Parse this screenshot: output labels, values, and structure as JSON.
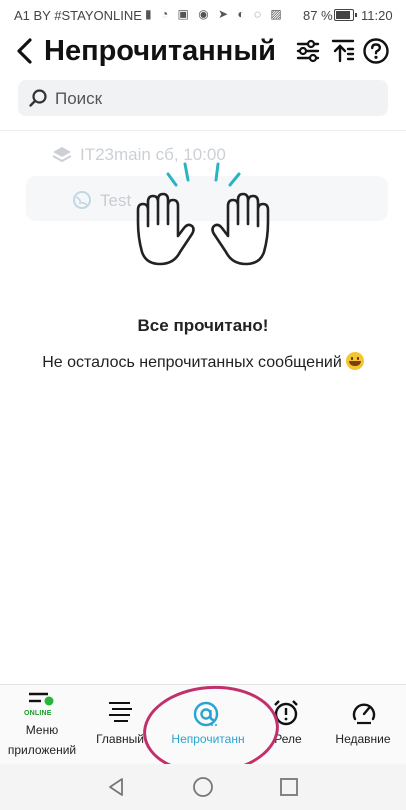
{
  "status_bar": {
    "carrier": "A1 BY #STAYONLINE",
    "battery": "87 %",
    "time": "11:20"
  },
  "header": {
    "title": "Непрочитанный",
    "back_icon": "chevron-left-icon",
    "filter_icon": "sliders-icon",
    "sort_icon": "sort-top-icon",
    "help_icon": "help-circle-icon"
  },
  "search": {
    "placeholder": "Поиск"
  },
  "ghost_items": {
    "server": "IT23main сб, 10:00",
    "channel": "Test"
  },
  "empty_state": {
    "illustration": "waving-hands-icon",
    "title": "Все прочитано!",
    "subtitle": "Не осталось непрочитанных сообщений"
  },
  "tabs": [
    {
      "label": "Меню\nприложений",
      "badge": "ONLINE",
      "icon": "menu-icon"
    },
    {
      "label": "Главный",
      "icon": "lines-icon"
    },
    {
      "label": "Непрочитанн",
      "icon": "at-icon",
      "active": true
    },
    {
      "label": "Реле",
      "icon": "alarm-icon"
    },
    {
      "label": "Недавние",
      "icon": "recent-icon"
    }
  ],
  "colors": {
    "accent": "#2ba3d1",
    "annotation": "#c2306b",
    "online": "#1a9d2b"
  }
}
